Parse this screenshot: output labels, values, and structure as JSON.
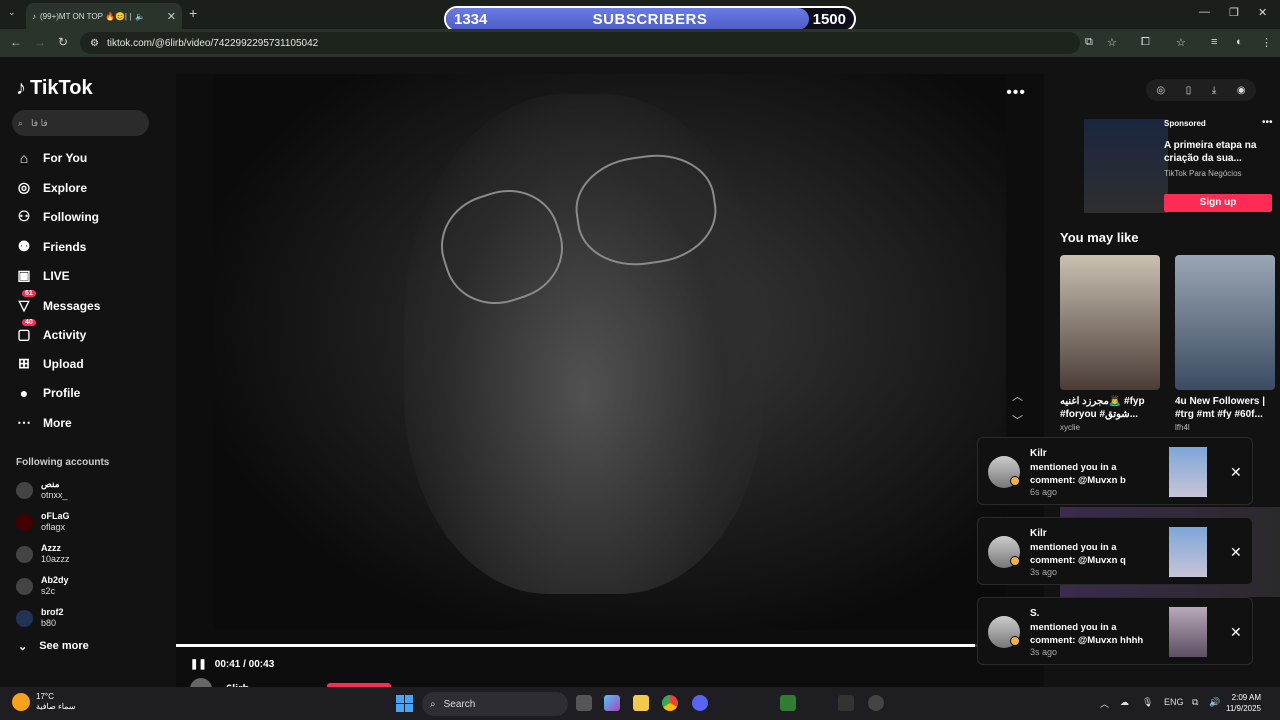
{
  "browser": {
    "tab_title": "(99+)MT ON TOP 🔥😊| |",
    "url": "tiktok.com/@6lirb/video/7422992295731105042"
  },
  "subscriber_bar": {
    "current": "1334",
    "label": "SUBSCRIBERS",
    "goal": "1500",
    "progress_fraction": 0.889
  },
  "sidebar": {
    "logo": "TikTok",
    "search_placeholder": "فا فا",
    "nav": [
      {
        "label": "For You",
        "icon": "home-icon"
      },
      {
        "label": "Explore",
        "icon": "compass-icon"
      },
      {
        "label": "Following",
        "icon": "following-icon"
      },
      {
        "label": "Friends",
        "icon": "friends-icon"
      },
      {
        "label": "LIVE",
        "icon": "live-icon"
      },
      {
        "label": "Messages",
        "icon": "messages-icon",
        "badge": "61"
      },
      {
        "label": "Activity",
        "icon": "activity-icon",
        "badge": "40"
      },
      {
        "label": "Upload",
        "icon": "upload-icon"
      },
      {
        "label": "Profile",
        "icon": "profile-icon"
      },
      {
        "label": "More",
        "icon": "more-icon"
      }
    ],
    "following_title": "Following accounts",
    "following": [
      {
        "name": "منص",
        "handle": "otnxx_"
      },
      {
        "name": "oFLaG",
        "handle": "oflagx"
      },
      {
        "name": "Azzz",
        "handle": "10azzz"
      },
      {
        "name": "Ab2dy",
        "handle": "s2c"
      },
      {
        "name": "brof2",
        "handle": "b80"
      }
    ],
    "see_more": "See more"
  },
  "player": {
    "time": "00:41 / 00:43",
    "progress_fraction": 0.92,
    "author": "6lirb"
  },
  "right": {
    "sponsored_label": "Sponsored",
    "sponsored_title": "A primeira etapa na criação da sua...",
    "sponsored_source": "TikTok Para Negócios",
    "signup": "Sign up",
    "you_may_like": "You may like",
    "cards": [
      {
        "title": "مجرزد اغنيه🙇‍♂️ #fyp #foryou #شوتق...",
        "author": "xyclie"
      },
      {
        "title": "4u New Followers | #trg #mt #fy #60f...",
        "author": "lfh4l"
      }
    ]
  },
  "notifications": [
    {
      "user": "Kilr",
      "message": "mentioned you in a comment: @Muvxn b",
      "time": "6s ago"
    },
    {
      "user": "Kilr",
      "message": "mentioned you in a comment: @Muvxn q",
      "time": "3s ago"
    },
    {
      "user": "S.",
      "message": "mentioned you in a comment: @Muvxn hhhh",
      "time": "3s ago"
    }
  ],
  "taskbar": {
    "temp": "17°C",
    "weather": "سماء صافية",
    "search": "Search",
    "lang": "ENG",
    "time": "2:09 AM",
    "date": "11/9/2025"
  },
  "colors": {
    "accent": "#fe2c55",
    "sub_fill": "#5a6bd8"
  }
}
